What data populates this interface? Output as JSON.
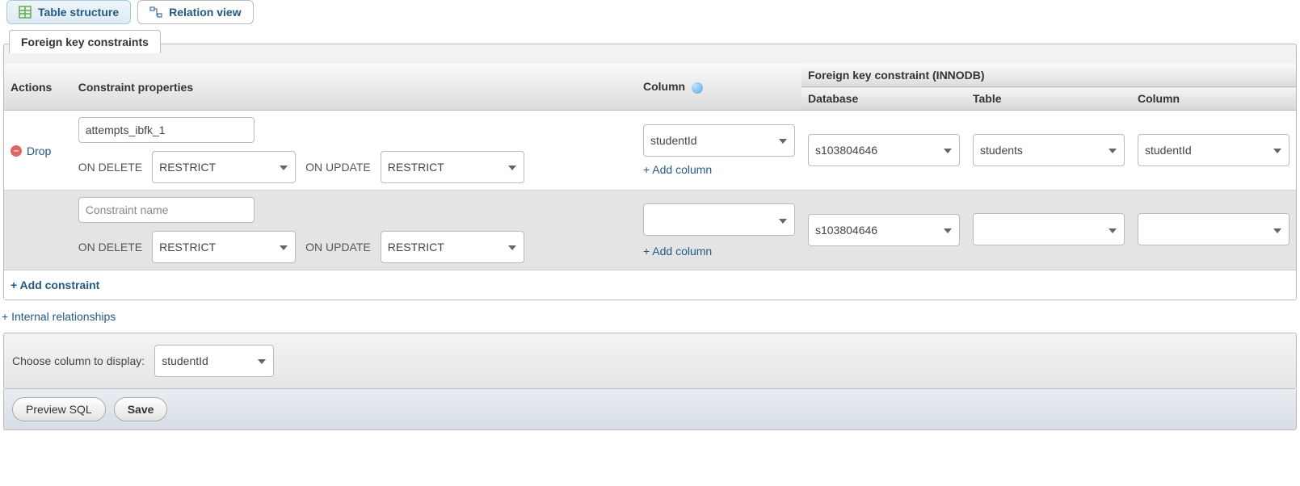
{
  "tabs": {
    "structure_label": "Table structure",
    "relation_label": "Relation view"
  },
  "section": {
    "title": "Foreign key constraints",
    "headers": {
      "actions": "Actions",
      "props": "Constraint properties",
      "column": "Column",
      "fk": "Foreign key constraint (INNODB)",
      "database": "Database",
      "table": "Table",
      "fk_column": "Column"
    },
    "labels": {
      "on_delete": "ON DELETE",
      "on_update": "ON UPDATE",
      "add_column": "+ Add column",
      "add_constraint": "+ Add constraint",
      "constraint_placeholder": "Constraint name",
      "drop": "Drop"
    },
    "rows": [
      {
        "name": "attempts_ibfk_1",
        "on_delete": "RESTRICT",
        "on_update": "RESTRICT",
        "column": "studentId",
        "database": "s103804646",
        "table": "students",
        "fk_column": "studentId",
        "droppable": true
      },
      {
        "name": "",
        "on_delete": "RESTRICT",
        "on_update": "RESTRICT",
        "column": "",
        "database": "s103804646",
        "table": "",
        "fk_column": "",
        "droppable": false
      }
    ]
  },
  "internal_relationships": "+ Internal relationships",
  "choose_column": {
    "label": "Choose column to display:",
    "value": "studentId"
  },
  "footer": {
    "preview": "Preview SQL",
    "save": "Save"
  }
}
